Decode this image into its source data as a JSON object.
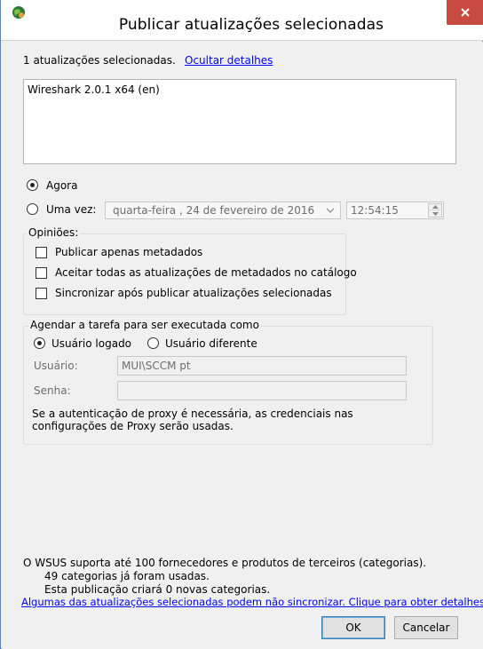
{
  "window": {
    "title": "Publicar atualizações selecionadas"
  },
  "summary": {
    "count_text": "1 atualizações selecionadas.",
    "hide_details_link": "Ocultar detalhes"
  },
  "updates_list": [
    "Wireshark 2.0.1 x64 (en)"
  ],
  "schedule": {
    "now_label": "Agora",
    "now_checked": true,
    "once_label": "Uma vez:",
    "once_checked": false,
    "date_value": "quarta-feira  , 24 de  fevereiro  de 2016",
    "time_value": "12:54:15"
  },
  "options": {
    "group_label": "Opiniões:",
    "items": [
      {
        "label": "Publicar apenas metadados",
        "checked": false
      },
      {
        "label": "Aceitar todas as atualizações de metadados no catálogo",
        "checked": false
      },
      {
        "label": "Sincronizar após publicar atualizações selecionadas",
        "checked": false
      }
    ]
  },
  "run_as": {
    "group_label": "Agendar a tarefa para ser executada como",
    "logged_user_label": "Usuário logado",
    "logged_user_checked": true,
    "other_user_label": "Usuário diferente",
    "other_user_checked": false,
    "user_label": "Usuário:",
    "user_value": "MUI\\SCCM pt",
    "password_label": "Senha:",
    "password_value": "",
    "proxy_note": "Se a autenticação de proxy é necessária, as credenciais nas configurações de Proxy serão usadas."
  },
  "footer": {
    "line1": "O WSUS suporta até 100 fornecedores e produtos de terceiros (categorias).",
    "line2": "49 categorias já foram usadas.",
    "line3": "Esta publicação criará 0 novas categorias.",
    "warning_link": "Algumas das atualizações selecionadas podem não sincronizar. Clique para obter detalhes."
  },
  "buttons": {
    "ok": "OK",
    "cancel": "Cancelar"
  },
  "colors": {
    "close_button": "#c74b3e",
    "link": "#0000ff"
  }
}
